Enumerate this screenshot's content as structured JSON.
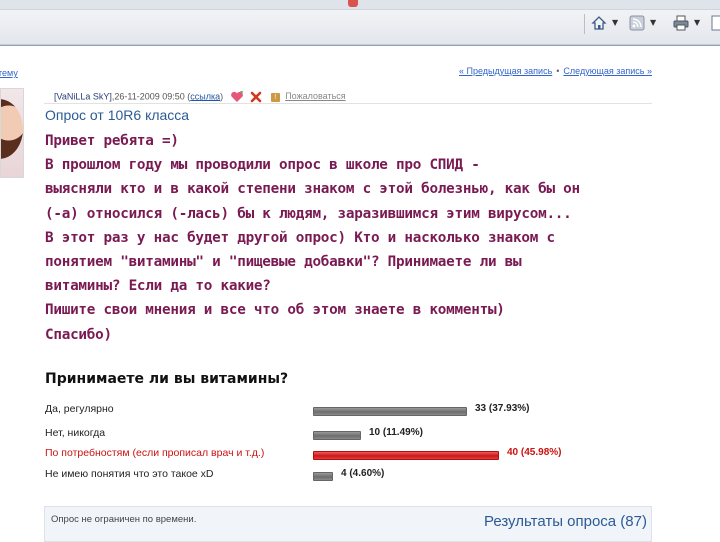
{
  "browser": {
    "icons": [
      "home-icon",
      "rss-icon",
      "print-icon",
      "page-icon"
    ]
  },
  "navigation": {
    "back_link": "тему",
    "prev": "« Предыдущая запись",
    "separator": "•",
    "next": "Следующая запись »"
  },
  "post": {
    "author": "[VaNiLLa SkY]",
    "date": ",26-11-2009 09:50",
    "link_label": "ссылка",
    "complain_label": "Пожаловаться",
    "title": "Опрос от 10R6 класса",
    "lines": [
      "Привет ребята =)",
      "В прошлом году мы проводили опрос в школе про СПИД -",
      "выясняли кто и в какой степени знаком с этой болезнью, как бы он",
      "(-а) относился (-лась) бы к людям, заразившимся этим вирусом...",
      "В этот раз у нас будет другой опрос) Кто и насколько знаком с",
      "понятием \"витамины\" и \"пищевые добавки\"? Принимаете ли вы",
      "витамины? Если да то какие?",
      "Пишите свои мнения и все что об этом знаете в комменты)",
      "Спасибо)"
    ],
    "text_color": "#7a1a52"
  },
  "poll": {
    "question": "Принимаете ли вы витамины?",
    "options": [
      {
        "label": "Да, регулярно",
        "count_text": "33 (37.93%)",
        "percent": 37.93,
        "highlight": false
      },
      {
        "label": "Нет, никогда",
        "count_text": "10 (11.49%)",
        "percent": 11.49,
        "highlight": false
      },
      {
        "label": "По потребностям (если прописал врач и т.д.)",
        "count_text": "40 (45.98%)",
        "percent": 45.98,
        "highlight": true
      },
      {
        "label": "Не имею понятия что это такое xD",
        "count_text": "4 (4.60%)",
        "percent": 4.6,
        "highlight": false
      }
    ],
    "footer_note": "Опрос не ограничен по времени.",
    "results_link": "Результаты опроса (87)",
    "colors": {
      "default": "#222222",
      "highlight": "#cc1111",
      "link": "#2b5b94"
    }
  }
}
